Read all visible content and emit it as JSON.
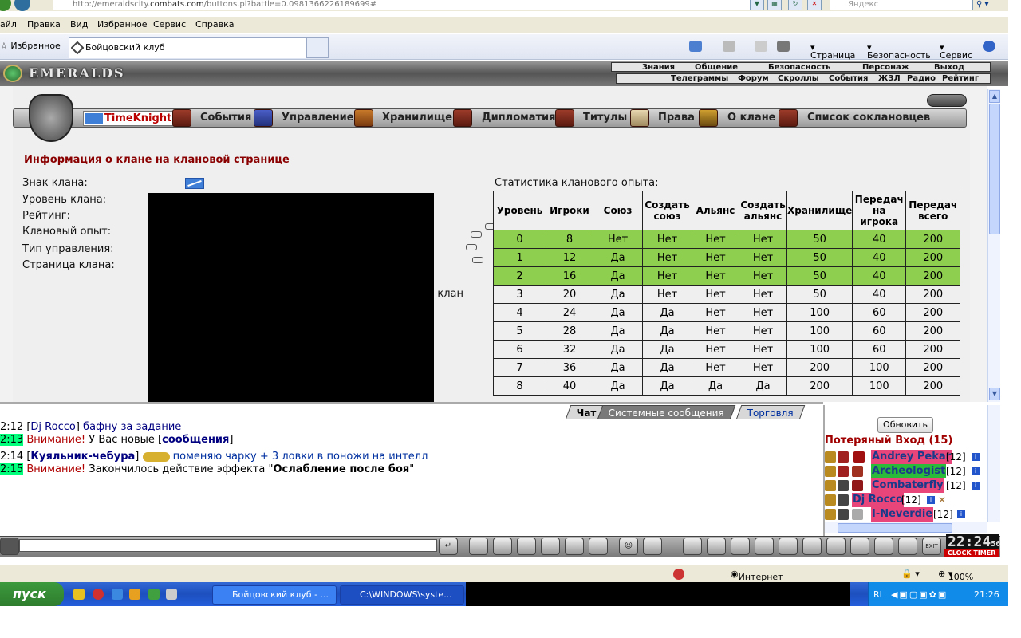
{
  "browser": {
    "url_prefix": "http://emeraldscity.",
    "url_domain": "combats.com",
    "url_path": "/buttons.pl?battle=0.0981366226189699#",
    "search_placeholder": "Яндекс",
    "menu": [
      "айл",
      "Правка",
      "Вид",
      "Избранное",
      "Сервис",
      "Справка"
    ],
    "favorites": "Избранное",
    "tab_title": "Бойцовский клуб",
    "tools": [
      "Страница",
      "Безопасность",
      "Сервис"
    ],
    "status_zone": "Интернет",
    "zoom": "100%"
  },
  "header": {
    "logo": "EMERALDS",
    "top_links": [
      "Знания",
      "Общение",
      "Безопасность",
      "Персонаж",
      "Выход"
    ],
    "bottom_links": [
      "Телеграммы",
      "Форум",
      "Скроллы",
      "События",
      "ЖЗЛ",
      "Радио",
      "Рейтинг"
    ]
  },
  "clan_nav": {
    "active": "TimeKnights",
    "items": [
      "События",
      "Управление",
      "Хранилище",
      "Дипломатия",
      "Титулы",
      "Права",
      "О клане",
      "Список соклановцев"
    ]
  },
  "info": {
    "title": "Информация о клане на клановой странице",
    "labels": [
      "Знак клана:",
      "Уровень клана:",
      "Рейтинг:",
      "Клановый опыт:",
      "Тип управления:",
      "Страница клана:"
    ],
    "partial_text": "ы клан"
  },
  "stats": {
    "title": "Статистика кланового опыта:",
    "headers": [
      "Уровень",
      "Игроки",
      "Союз",
      "Создать союз",
      "Альянс",
      "Создать альянс",
      "Хранилище",
      "Передач на игрока",
      "Передач всего"
    ],
    "rows": [
      [
        "0",
        "8",
        "Нет",
        "Нет",
        "Нет",
        "Нет",
        "50",
        "40",
        "200"
      ],
      [
        "1",
        "12",
        "Да",
        "Нет",
        "Нет",
        "Нет",
        "50",
        "40",
        "200"
      ],
      [
        "2",
        "16",
        "Да",
        "Нет",
        "Нет",
        "Нет",
        "50",
        "40",
        "200"
      ],
      [
        "3",
        "20",
        "Да",
        "Нет",
        "Нет",
        "Нет",
        "50",
        "40",
        "200"
      ],
      [
        "4",
        "24",
        "Да",
        "Да",
        "Нет",
        "Нет",
        "100",
        "60",
        "200"
      ],
      [
        "5",
        "28",
        "Да",
        "Да",
        "Нет",
        "Нет",
        "100",
        "60",
        "200"
      ],
      [
        "6",
        "32",
        "Да",
        "Да",
        "Нет",
        "Нет",
        "100",
        "60",
        "200"
      ],
      [
        "7",
        "36",
        "Да",
        "Да",
        "Нет",
        "Нет",
        "200",
        "100",
        "200"
      ],
      [
        "8",
        "40",
        "Да",
        "Да",
        "Да",
        "Да",
        "200",
        "100",
        "200"
      ]
    ],
    "highlighted_rows": [
      0,
      1,
      2
    ]
  },
  "chat": {
    "tabs": [
      "Чат",
      "Системные сообщения",
      "Торговля"
    ],
    "lines": [
      {
        "time": "2:12",
        "nick": "Dj Rocco",
        "text": "бафну за задание"
      },
      {
        "time": "2:13",
        "warn": "Внимание!",
        "text": "У Вас новые [",
        "link": "сообщения",
        "end": "]"
      },
      {
        "time": "2:14",
        "nick": "Куяльник-чебура",
        "text": "поменяю чарку + 3 ловки в поножи на интелл"
      },
      {
        "time": "2:15",
        "warn": "Внимание!",
        "text": "Закончилось действие эффекта \"",
        "bold": "Ослабление после боя",
        "end": "\""
      }
    ]
  },
  "online": {
    "refresh": "Обновить",
    "room": "Потеряный Вход (15)",
    "players": [
      {
        "name": "Andrey Pekar",
        "level": "[12]",
        "color": "#e8457a"
      },
      {
        "name": "Archeologist",
        "level": "[12]",
        "color": "#2bbb3a"
      },
      {
        "name": "Combaterfly",
        "level": "[12]",
        "color": "#e8457a"
      },
      {
        "name": "Dj Rocco",
        "level": "[12]",
        "color": "#e8457a"
      },
      {
        "name": "I-Neverdie",
        "level": "[12]",
        "color": "#e8457a"
      }
    ]
  },
  "clock": {
    "time": "22:24",
    "sec": "56",
    "label": "CLOCK TIMER"
  },
  "taskbar": {
    "start": "пуск",
    "buttons": [
      "Бойцовский клуб - ...",
      "C:\\WINDOWS\\syste..."
    ],
    "lang": "RL",
    "time": "21:26"
  }
}
